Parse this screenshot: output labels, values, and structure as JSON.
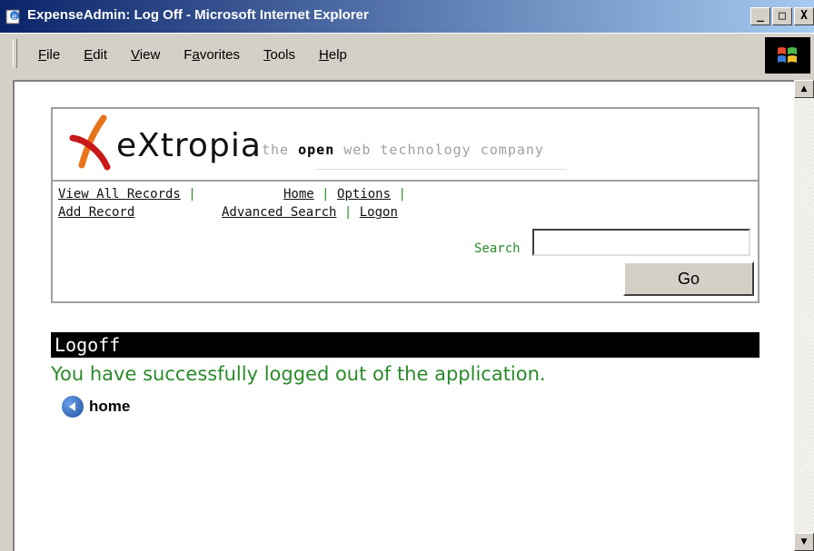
{
  "window": {
    "title": "ExpenseAdmin: Log Off - Microsoft Internet Explorer",
    "controls": [
      "_",
      "□",
      "X"
    ]
  },
  "menu": {
    "items": [
      {
        "accel": "F",
        "rest": "ile"
      },
      {
        "accel": "E",
        "rest": "dit"
      },
      {
        "accel": "V",
        "rest": "iew"
      },
      {
        "pre": "F",
        "accel": "a",
        "rest": "vorites"
      },
      {
        "accel": "T",
        "rest": "ools"
      },
      {
        "accel": "H",
        "rest": "elp"
      }
    ]
  },
  "logo": {
    "name": "eXtropia",
    "tagline_pre": "the ",
    "tagline_bold": "open",
    "tagline_post": " web technology company"
  },
  "nav": {
    "view_all": "View All Records",
    "add_record": "Add Record",
    "home": "Home",
    "options": "Options",
    "advanced_search": "Advanced Search",
    "logon": "Logon",
    "separator": "|"
  },
  "search": {
    "label": "Search",
    "value": "",
    "button": "Go"
  },
  "logoff": {
    "heading": "Logoff",
    "message": "You have successfully logged out of the application.",
    "home_link": "home"
  },
  "colors": {
    "accent_green": "#2a8a2a",
    "titlebar_start": "#0a246a",
    "titlebar_end": "#a6caf0"
  },
  "icons": {
    "title": "ie-page-icon",
    "throbber": "windows-logo-icon",
    "home": "back-arrow-circle-icon"
  }
}
